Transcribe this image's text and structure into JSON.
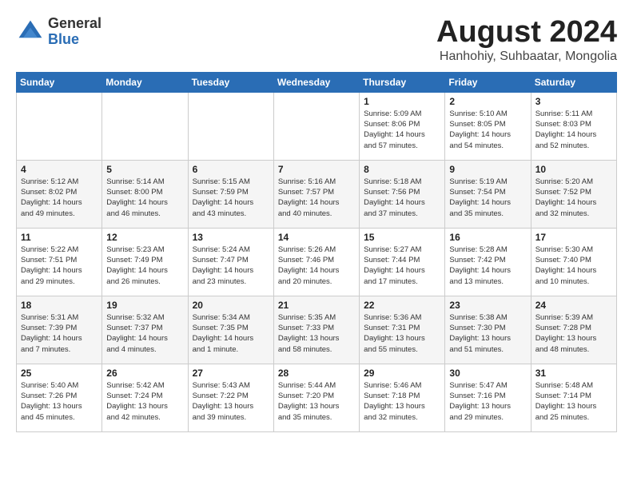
{
  "logo": {
    "general": "General",
    "blue": "Blue"
  },
  "title": {
    "month": "August 2024",
    "location": "Hanhohiy, Suhbaatar, Mongolia"
  },
  "weekdays": [
    "Sunday",
    "Monday",
    "Tuesday",
    "Wednesday",
    "Thursday",
    "Friday",
    "Saturday"
  ],
  "weeks": [
    [
      {
        "day": "",
        "info": ""
      },
      {
        "day": "",
        "info": ""
      },
      {
        "day": "",
        "info": ""
      },
      {
        "day": "",
        "info": ""
      },
      {
        "day": "1",
        "info": "Sunrise: 5:09 AM\nSunset: 8:06 PM\nDaylight: 14 hours\nand 57 minutes."
      },
      {
        "day": "2",
        "info": "Sunrise: 5:10 AM\nSunset: 8:05 PM\nDaylight: 14 hours\nand 54 minutes."
      },
      {
        "day": "3",
        "info": "Sunrise: 5:11 AM\nSunset: 8:03 PM\nDaylight: 14 hours\nand 52 minutes."
      }
    ],
    [
      {
        "day": "4",
        "info": "Sunrise: 5:12 AM\nSunset: 8:02 PM\nDaylight: 14 hours\nand 49 minutes."
      },
      {
        "day": "5",
        "info": "Sunrise: 5:14 AM\nSunset: 8:00 PM\nDaylight: 14 hours\nand 46 minutes."
      },
      {
        "day": "6",
        "info": "Sunrise: 5:15 AM\nSunset: 7:59 PM\nDaylight: 14 hours\nand 43 minutes."
      },
      {
        "day": "7",
        "info": "Sunrise: 5:16 AM\nSunset: 7:57 PM\nDaylight: 14 hours\nand 40 minutes."
      },
      {
        "day": "8",
        "info": "Sunrise: 5:18 AM\nSunset: 7:56 PM\nDaylight: 14 hours\nand 37 minutes."
      },
      {
        "day": "9",
        "info": "Sunrise: 5:19 AM\nSunset: 7:54 PM\nDaylight: 14 hours\nand 35 minutes."
      },
      {
        "day": "10",
        "info": "Sunrise: 5:20 AM\nSunset: 7:52 PM\nDaylight: 14 hours\nand 32 minutes."
      }
    ],
    [
      {
        "day": "11",
        "info": "Sunrise: 5:22 AM\nSunset: 7:51 PM\nDaylight: 14 hours\nand 29 minutes."
      },
      {
        "day": "12",
        "info": "Sunrise: 5:23 AM\nSunset: 7:49 PM\nDaylight: 14 hours\nand 26 minutes."
      },
      {
        "day": "13",
        "info": "Sunrise: 5:24 AM\nSunset: 7:47 PM\nDaylight: 14 hours\nand 23 minutes."
      },
      {
        "day": "14",
        "info": "Sunrise: 5:26 AM\nSunset: 7:46 PM\nDaylight: 14 hours\nand 20 minutes."
      },
      {
        "day": "15",
        "info": "Sunrise: 5:27 AM\nSunset: 7:44 PM\nDaylight: 14 hours\nand 17 minutes."
      },
      {
        "day": "16",
        "info": "Sunrise: 5:28 AM\nSunset: 7:42 PM\nDaylight: 14 hours\nand 13 minutes."
      },
      {
        "day": "17",
        "info": "Sunrise: 5:30 AM\nSunset: 7:40 PM\nDaylight: 14 hours\nand 10 minutes."
      }
    ],
    [
      {
        "day": "18",
        "info": "Sunrise: 5:31 AM\nSunset: 7:39 PM\nDaylight: 14 hours\nand 7 minutes."
      },
      {
        "day": "19",
        "info": "Sunrise: 5:32 AM\nSunset: 7:37 PM\nDaylight: 14 hours\nand 4 minutes."
      },
      {
        "day": "20",
        "info": "Sunrise: 5:34 AM\nSunset: 7:35 PM\nDaylight: 14 hours\nand 1 minute."
      },
      {
        "day": "21",
        "info": "Sunrise: 5:35 AM\nSunset: 7:33 PM\nDaylight: 13 hours\nand 58 minutes."
      },
      {
        "day": "22",
        "info": "Sunrise: 5:36 AM\nSunset: 7:31 PM\nDaylight: 13 hours\nand 55 minutes."
      },
      {
        "day": "23",
        "info": "Sunrise: 5:38 AM\nSunset: 7:30 PM\nDaylight: 13 hours\nand 51 minutes."
      },
      {
        "day": "24",
        "info": "Sunrise: 5:39 AM\nSunset: 7:28 PM\nDaylight: 13 hours\nand 48 minutes."
      }
    ],
    [
      {
        "day": "25",
        "info": "Sunrise: 5:40 AM\nSunset: 7:26 PM\nDaylight: 13 hours\nand 45 minutes."
      },
      {
        "day": "26",
        "info": "Sunrise: 5:42 AM\nSunset: 7:24 PM\nDaylight: 13 hours\nand 42 minutes."
      },
      {
        "day": "27",
        "info": "Sunrise: 5:43 AM\nSunset: 7:22 PM\nDaylight: 13 hours\nand 39 minutes."
      },
      {
        "day": "28",
        "info": "Sunrise: 5:44 AM\nSunset: 7:20 PM\nDaylight: 13 hours\nand 35 minutes."
      },
      {
        "day": "29",
        "info": "Sunrise: 5:46 AM\nSunset: 7:18 PM\nDaylight: 13 hours\nand 32 minutes."
      },
      {
        "day": "30",
        "info": "Sunrise: 5:47 AM\nSunset: 7:16 PM\nDaylight: 13 hours\nand 29 minutes."
      },
      {
        "day": "31",
        "info": "Sunrise: 5:48 AM\nSunset: 7:14 PM\nDaylight: 13 hours\nand 25 minutes."
      }
    ]
  ]
}
